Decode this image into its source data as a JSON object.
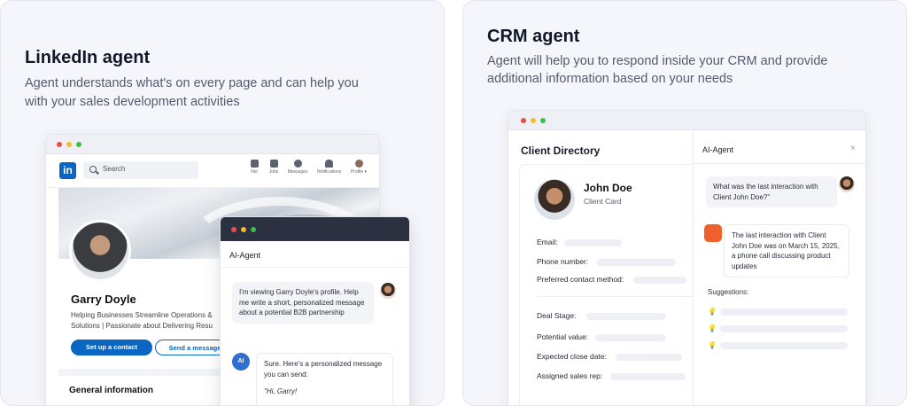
{
  "left_card": {
    "title": "LinkedIn agent",
    "desc_line1": "Agent understands what's on every page and can help you",
    "desc_line2": "with your sales development activities"
  },
  "linkedin": {
    "logo": "in",
    "search_placeholder": "Search",
    "nav": [
      "Net",
      "Jobs",
      "Messages",
      "Notifications",
      "Profile ▾"
    ],
    "name": "Garry Doyle",
    "headline_line1": "Helping Businesses Streamline Operations & ",
    "headline_line2": "Solutions | Passionate about Delivering Resu",
    "btn_contact": "Set up a contact",
    "btn_message": "Send a message",
    "general": "General information"
  },
  "left_ai": {
    "title": "AI-Agent",
    "user_msg": "I'm viewing Garry Doyle's profile. Help me write a short, personalized message about a potential B2B partnership",
    "badge": "AI",
    "reply": "Sure. Here's a personalized message you can send:",
    "reply_quote": "\"Hi, Garry!"
  },
  "right_card": {
    "title": "CRM agent",
    "desc_line1": "Agent will help you to respond inside your CRM and provide",
    "desc_line2": "additional information based on your needs"
  },
  "crm": {
    "title": "Client Directory",
    "client_name": "John Doe",
    "client_sub": "Client Card",
    "fields_top": [
      "Email:",
      "Phone number:",
      "Preferred contact method:"
    ],
    "fields_bottom": [
      "Deal Stage:",
      "Potential value:",
      "Expected close date:",
      "Assigned sales rep:"
    ]
  },
  "crm_ai": {
    "title": "AI-Agent",
    "close": "×",
    "user_msg": "What was the last interaction with Client John Doe?\"",
    "reply": "The last interaction with Client John Doe was on March 15, 2025, a phone call discussing product updates",
    "suggestions_label": "Suggestions:",
    "bulb": "💡"
  }
}
